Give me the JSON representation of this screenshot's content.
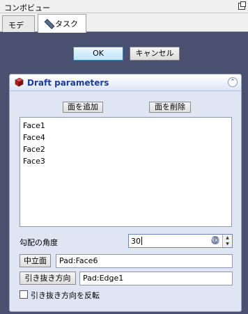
{
  "window": {
    "title": "コンボビュー",
    "float_icon": "float-icon"
  },
  "tabs": [
    {
      "label": "モデル",
      "active": false
    },
    {
      "label": "タスク",
      "active": true,
      "icon": "pencil-icon"
    }
  ],
  "dialog": {
    "ok_label": "OK",
    "cancel_label": "キャンセル"
  },
  "panel": {
    "title": "Draft parameters",
    "icon": "draft-icon",
    "collapse_icon": "collapse-icon",
    "add_face_label": "面を追加",
    "remove_face_label": "面を削除",
    "faces": [
      "Face1",
      "Face4",
      "Face2",
      "Face3"
    ],
    "angle_label": "勾配の角度",
    "angle_value": "30",
    "neutral_plane_button": "中立面",
    "neutral_plane_value": "Pad:Face6",
    "pull_direction_button": "引き抜き方向",
    "pull_direction_value": "Pad:Edge1",
    "reverse_label": "引き抜き方向を反転",
    "reverse_checked": false
  },
  "colors": {
    "accent": "#1a3c9a",
    "panel_bg": "#dfe5f3",
    "backdrop": "#4a5170"
  }
}
